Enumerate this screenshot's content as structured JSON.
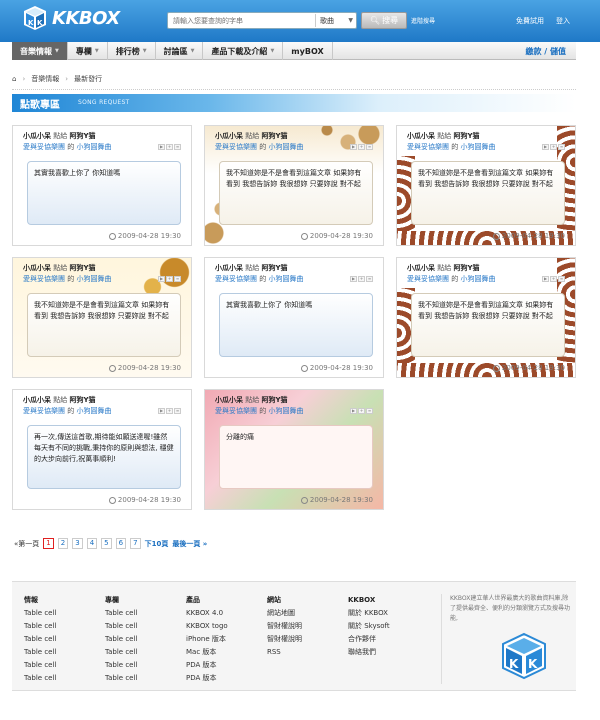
{
  "header": {
    "logo": "KKBOX",
    "search_placeholder": "請輸入您要查詢的字串",
    "search_type": "歌曲",
    "search_button": "搜尋",
    "advanced_search": "進階搜尋",
    "free_trial": "免費試用",
    "login": "登入"
  },
  "nav": {
    "items": [
      {
        "label": "音樂情報"
      },
      {
        "label": "專欄"
      },
      {
        "label": "排行榜"
      },
      {
        "label": "討論區"
      },
      {
        "label": "產品下載及介紹"
      },
      {
        "label": "myBOX"
      }
    ],
    "right_link": "繳款 / 儲值"
  },
  "breadcrumb": {
    "items": [
      "音樂情報",
      "最新發行"
    ]
  },
  "section": {
    "title": "點歌專區",
    "subtitle": "SONG REQUEST"
  },
  "cards": [
    {
      "from": "小瓜小呆",
      "verb": "點給",
      "to": "阿狗Y猫",
      "artist": "愛與妥協樂團",
      "of": "的",
      "song": "小狗圓舞曲",
      "message": "其實我喜歡上你了 你知道嗎",
      "date": "2009-04-28 19:30"
    },
    {
      "from": "小瓜小呆",
      "verb": "點給",
      "to": "阿狗Y猫",
      "artist": "愛與妥協樂團",
      "of": "的",
      "song": "小狗圓舞曲",
      "message": "我不知道妳是不是會看到這篇文章 如果妳有看到 我想告訴妳 我很想妳 只要妳說 對不起",
      "date": "2009-04-28 19:30"
    },
    {
      "from": "小瓜小呆",
      "verb": "點給",
      "to": "阿狗Y猫",
      "artist": "愛與妥協樂團",
      "of": "的",
      "song": "小狗圓舞曲",
      "message": "我不知道妳是不是會看到這篇文章 如果妳有看到 我想告訴妳 我很想妳 只要妳說 對不起",
      "date": "2009-04-28 19:30"
    },
    {
      "from": "小瓜小呆",
      "verb": "點給",
      "to": "阿狗Y猫",
      "artist": "愛與妥協樂團",
      "of": "的",
      "song": "小狗圓舞曲",
      "message": "我不知道妳是不是會看到這篇文章 如果妳有看到 我想告訴妳 我很想妳 只要妳說 對不起",
      "date": "2009-04-28 19:30"
    },
    {
      "from": "小瓜小呆",
      "verb": "點給",
      "to": "阿狗Y猫",
      "artist": "愛與妥協樂團",
      "of": "的",
      "song": "小狗圓舞曲",
      "message": "其實我喜歡上你了 你知道嗎",
      "date": "2009-04-28 19:30"
    },
    {
      "from": "小瓜小呆",
      "verb": "點給",
      "to": "阿狗Y猫",
      "artist": "愛與妥協樂團",
      "of": "的",
      "song": "小狗圓舞曲",
      "message": "我不知道妳是不是會看到這篇文章 如果妳有看到 我想告訴妳 我很想妳 只要妳說 對不起",
      "date": "2009-04-28 19:30"
    },
    {
      "from": "小瓜小呆",
      "verb": "點給",
      "to": "阿狗Y猫",
      "artist": "愛與妥協樂團",
      "of": "的",
      "song": "小狗圓舞曲",
      "message": "再一次,傳送這首歌,期待能如願送達喔!雖然每天有不同的挑戰,秉持你的原則與想法, 穩健的大步向前行,祝萬事順利!",
      "date": "2009-04-28 19:30"
    },
    {
      "from": "小瓜小呆",
      "verb": "點給",
      "to": "阿狗Y猫",
      "artist": "愛與妥協樂團",
      "of": "的",
      "song": "小狗圓舞曲",
      "message": "分離的痛",
      "date": "2009-04-28 19:30"
    }
  ],
  "pagination": {
    "first": "«第一頁",
    "pages": [
      "1",
      "2",
      "3",
      "4",
      "5",
      "6",
      "7"
    ],
    "current": "1",
    "next10": "下10頁",
    "last": "最後一頁 »"
  },
  "footer": {
    "columns": [
      {
        "title": "情報",
        "items": [
          "Table cell",
          "Table cell",
          "Table cell",
          "Table cell",
          "Table cell",
          "Table cell"
        ]
      },
      {
        "title": "專欄",
        "items": [
          "Table cell",
          "Table cell",
          "Table cell",
          "Table cell",
          "Table cell",
          "Table cell"
        ]
      },
      {
        "title": "產品",
        "items": [
          "KKBOX 4.0",
          "KKBOX togo",
          "iPhone 版本",
          "Mac 版本",
          "PDA 版本",
          "PDA 版本"
        ]
      },
      {
        "title": "網站",
        "items": [
          "網站地圖",
          "智財權說明",
          "智財權說明",
          "RSS"
        ]
      },
      {
        "title": "KKBOX",
        "items": [
          "關於 KKBOX",
          "關於 Skysoft",
          "合作夥伴",
          "聯絡我們"
        ]
      }
    ],
    "description": "KKBOX建立華人世界最廣大的歌曲資料庫,除了提供最齊全、便利的分類瀏覽方式及搜尋功能,"
  },
  "colors": {
    "header_blue": "#1f79c7",
    "link_blue": "#1a6fc0",
    "current_page": "#e02020"
  }
}
